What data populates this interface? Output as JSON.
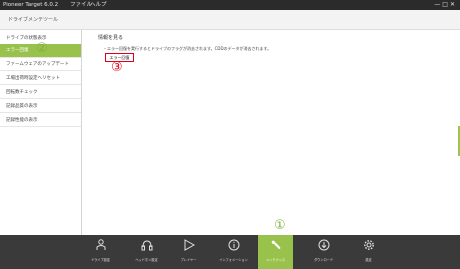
{
  "titlebar": {
    "app_title": "Pioneer Target 6.0.2",
    "menu_file": "ファイル",
    "menu_help": "ヘルプ",
    "window_controls": "—□✕"
  },
  "subheader": {
    "title": "ドライブメンテツール"
  },
  "sidebar": {
    "items": [
      {
        "label": "ドライブの状態表示"
      },
      {
        "label": "エラー回復"
      },
      {
        "label": "ファームウェアのアップデート"
      },
      {
        "label": "工場出荷時設定へリセット"
      },
      {
        "label": "回転数チェック"
      },
      {
        "label": "記録品質の表示"
      },
      {
        "label": "記録性能の表示"
      }
    ]
  },
  "main": {
    "heading": "情報を見る",
    "description": "・エラー回復を実行するとドライブのフラグが消去されます。CDDのデータが消去されます。",
    "action_button": "エラー回復"
  },
  "badges": {
    "one": "①",
    "two": "②",
    "three": "③"
  },
  "bottom_tabs": [
    {
      "label": "ドライブ設定",
      "icon": "person-icon"
    },
    {
      "label": "ヘッドホン設定",
      "icon": "headphone-icon"
    },
    {
      "label": "プレイヤー",
      "icon": "play-icon"
    },
    {
      "label": "インフォメーション",
      "icon": "info-icon"
    },
    {
      "label": "メンテナンス",
      "icon": "wrench-icon"
    },
    {
      "label": "ダウンロード",
      "icon": "download-icon"
    },
    {
      "label": "設定",
      "icon": "gear-icon"
    }
  ],
  "colors": {
    "accent": "#98c24b",
    "highlight_red": "#e0001b",
    "dark_bar": "#3a3a3a"
  }
}
